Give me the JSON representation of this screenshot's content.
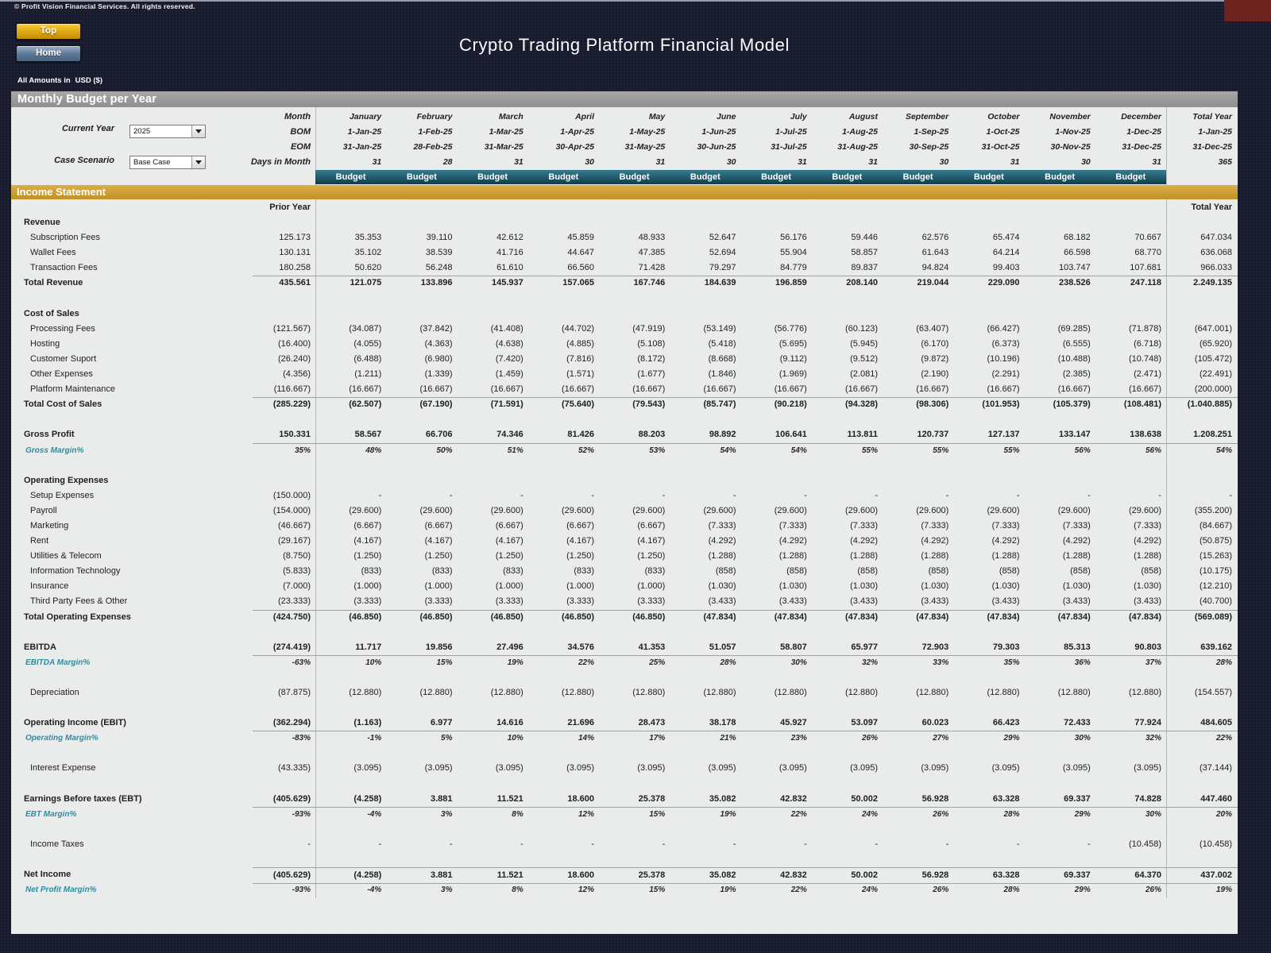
{
  "header": {
    "copyright": "© Profit Vision Financial Services. All rights reserved.",
    "title": "Crypto Trading Platform Financial Model",
    "amounts_label": "All Amounts in",
    "currency": "USD ($)",
    "top_button": "Top",
    "home_button": "Home"
  },
  "section_bar": "Monthly Budget per Year",
  "controls": {
    "current_year_label": "Current Year",
    "current_year_value": "2025",
    "case_scenario_label": "Case Scenario",
    "case_scenario_value": "Base Case"
  },
  "month_header": {
    "row_labels": [
      "Month",
      "BOM",
      "EOM",
      "Days in Month"
    ],
    "budget_label": "Budget",
    "months": [
      {
        "name": "January",
        "bom": "1-Jan-25",
        "eom": "31-Jan-25",
        "days": "31"
      },
      {
        "name": "February",
        "bom": "1-Feb-25",
        "eom": "28-Feb-25",
        "days": "28"
      },
      {
        "name": "March",
        "bom": "1-Mar-25",
        "eom": "31-Mar-25",
        "days": "31"
      },
      {
        "name": "April",
        "bom": "1-Apr-25",
        "eom": "30-Apr-25",
        "days": "30"
      },
      {
        "name": "May",
        "bom": "1-May-25",
        "eom": "31-May-25",
        "days": "31"
      },
      {
        "name": "June",
        "bom": "1-Jun-25",
        "eom": "30-Jun-25",
        "days": "30"
      },
      {
        "name": "July",
        "bom": "1-Jul-25",
        "eom": "31-Jul-25",
        "days": "31"
      },
      {
        "name": "August",
        "bom": "1-Aug-25",
        "eom": "31-Aug-25",
        "days": "31"
      },
      {
        "name": "September",
        "bom": "1-Sep-25",
        "eom": "30-Sep-25",
        "days": "30"
      },
      {
        "name": "October",
        "bom": "1-Oct-25",
        "eom": "31-Oct-25",
        "days": "31"
      },
      {
        "name": "November",
        "bom": "1-Nov-25",
        "eom": "30-Nov-25",
        "days": "30"
      },
      {
        "name": "December",
        "bom": "1-Dec-25",
        "eom": "31-Dec-25",
        "days": "31"
      }
    ],
    "total": {
      "name": "Total Year",
      "bom": "1-Jan-25",
      "eom": "31-Dec-25",
      "days": "365"
    }
  },
  "income_statement": {
    "bar_label": "Income Statement",
    "rows": [
      {
        "type": "colheader",
        "name": "column-header-row",
        "values": [
          "Prior Year",
          "",
          "",
          "",
          "",
          "",
          "",
          "",
          "",
          "",
          "",
          "",
          "",
          "Total Year"
        ]
      },
      {
        "type": "section",
        "name": "row-revenue-section",
        "label": "Revenue"
      },
      {
        "type": "item",
        "name": "row-subscription-fees",
        "label": "Subscription Fees",
        "values": [
          "125.173",
          "35.353",
          "39.110",
          "42.612",
          "45.859",
          "48.933",
          "52.647",
          "56.176",
          "59.446",
          "62.576",
          "65.474",
          "68.182",
          "70.667",
          "647.034"
        ]
      },
      {
        "type": "item",
        "name": "row-wallet-fees",
        "label": "Wallet Fees",
        "values": [
          "130.131",
          "35.102",
          "38.539",
          "41.716",
          "44.647",
          "47.385",
          "52.694",
          "55.904",
          "58.857",
          "61.643",
          "64.214",
          "66.598",
          "68.770",
          "636.068"
        ]
      },
      {
        "type": "item",
        "name": "row-transaction-fees",
        "label": "Transaction Fees",
        "underline": true,
        "values": [
          "180.258",
          "50.620",
          "56.248",
          "61.610",
          "66.560",
          "71.428",
          "79.297",
          "84.779",
          "89.837",
          "94.824",
          "99.403",
          "103.747",
          "107.681",
          "966.033"
        ]
      },
      {
        "type": "total",
        "name": "row-total-revenue",
        "label": "Total Revenue",
        "values": [
          "435.561",
          "121.075",
          "133.896",
          "145.937",
          "157.065",
          "167.746",
          "184.639",
          "196.859",
          "208.140",
          "219.044",
          "229.090",
          "238.526",
          "247.118",
          "2.249.135"
        ]
      },
      {
        "type": "blank"
      },
      {
        "type": "section",
        "name": "row-cost-of-sales-section",
        "label": "Cost of Sales"
      },
      {
        "type": "item",
        "name": "row-processing-fees",
        "label": "Processing Fees",
        "values": [
          "(121.567)",
          "(34.087)",
          "(37.842)",
          "(41.408)",
          "(44.702)",
          "(47.919)",
          "(53.149)",
          "(56.776)",
          "(60.123)",
          "(63.407)",
          "(66.427)",
          "(69.285)",
          "(71.878)",
          "(647.001)"
        ]
      },
      {
        "type": "item",
        "name": "row-hosting",
        "label": "Hosting",
        "values": [
          "(16.400)",
          "(4.055)",
          "(4.363)",
          "(4.638)",
          "(4.885)",
          "(5.108)",
          "(5.418)",
          "(5.695)",
          "(5.945)",
          "(6.170)",
          "(6.373)",
          "(6.555)",
          "(6.718)",
          "(65.920)"
        ]
      },
      {
        "type": "item",
        "name": "row-customer-suport",
        "label": "Customer Suport",
        "values": [
          "(26.240)",
          "(6.488)",
          "(6.980)",
          "(7.420)",
          "(7.816)",
          "(8.172)",
          "(8.668)",
          "(9.112)",
          "(9.512)",
          "(9.872)",
          "(10.196)",
          "(10.488)",
          "(10.748)",
          "(105.472)"
        ]
      },
      {
        "type": "item",
        "name": "row-other-expenses",
        "label": "Other Expenses",
        "values": [
          "(4.356)",
          "(1.211)",
          "(1.339)",
          "(1.459)",
          "(1.571)",
          "(1.677)",
          "(1.846)",
          "(1.969)",
          "(2.081)",
          "(2.190)",
          "(2.291)",
          "(2.385)",
          "(2.471)",
          "(22.491)"
        ]
      },
      {
        "type": "item",
        "name": "row-platform-maintenance",
        "label": "Platform Maintenance",
        "underline": true,
        "values": [
          "(116.667)",
          "(16.667)",
          "(16.667)",
          "(16.667)",
          "(16.667)",
          "(16.667)",
          "(16.667)",
          "(16.667)",
          "(16.667)",
          "(16.667)",
          "(16.667)",
          "(16.667)",
          "(16.667)",
          "(200.000)"
        ]
      },
      {
        "type": "total",
        "name": "row-total-cost-of-sales",
        "label": "Total Cost of Sales",
        "values": [
          "(285.229)",
          "(62.507)",
          "(67.190)",
          "(71.591)",
          "(75.640)",
          "(79.543)",
          "(85.747)",
          "(90.218)",
          "(94.328)",
          "(98.306)",
          "(101.953)",
          "(105.379)",
          "(108.481)",
          "(1.040.885)"
        ]
      },
      {
        "type": "blank"
      },
      {
        "type": "total",
        "name": "row-gross-profit",
        "label": "Gross Profit",
        "underline": true,
        "values": [
          "150.331",
          "58.567",
          "66.706",
          "74.346",
          "81.426",
          "88.203",
          "98.892",
          "106.641",
          "113.811",
          "120.737",
          "127.137",
          "133.147",
          "138.638",
          "1.208.251"
        ]
      },
      {
        "type": "margin",
        "name": "row-gross-margin",
        "label": "Gross Margin%",
        "values": [
          "35%",
          "48%",
          "50%",
          "51%",
          "52%",
          "53%",
          "54%",
          "54%",
          "55%",
          "55%",
          "55%",
          "56%",
          "56%",
          "54%"
        ]
      },
      {
        "type": "blank"
      },
      {
        "type": "section",
        "name": "row-operating-expenses-section",
        "label": "Operating Expenses"
      },
      {
        "type": "item",
        "name": "row-setup-expenses",
        "label": "Setup Expenses",
        "values": [
          "(150.000)",
          "-",
          "-",
          "-",
          "-",
          "-",
          "-",
          "-",
          "-",
          "-",
          "-",
          "-",
          "-",
          "-"
        ]
      },
      {
        "type": "item",
        "name": "row-payroll",
        "label": "Payroll",
        "values": [
          "(154.000)",
          "(29.600)",
          "(29.600)",
          "(29.600)",
          "(29.600)",
          "(29.600)",
          "(29.600)",
          "(29.600)",
          "(29.600)",
          "(29.600)",
          "(29.600)",
          "(29.600)",
          "(29.600)",
          "(355.200)"
        ]
      },
      {
        "type": "item",
        "name": "row-marketing",
        "label": "Marketing",
        "values": [
          "(46.667)",
          "(6.667)",
          "(6.667)",
          "(6.667)",
          "(6.667)",
          "(6.667)",
          "(7.333)",
          "(7.333)",
          "(7.333)",
          "(7.333)",
          "(7.333)",
          "(7.333)",
          "(7.333)",
          "(84.667)"
        ]
      },
      {
        "type": "item",
        "name": "row-rent",
        "label": "Rent",
        "values": [
          "(29.167)",
          "(4.167)",
          "(4.167)",
          "(4.167)",
          "(4.167)",
          "(4.167)",
          "(4.292)",
          "(4.292)",
          "(4.292)",
          "(4.292)",
          "(4.292)",
          "(4.292)",
          "(4.292)",
          "(50.875)"
        ]
      },
      {
        "type": "item",
        "name": "row-utilities-telecom",
        "label": "Utilities & Telecom",
        "values": [
          "(8.750)",
          "(1.250)",
          "(1.250)",
          "(1.250)",
          "(1.250)",
          "(1.250)",
          "(1.288)",
          "(1.288)",
          "(1.288)",
          "(1.288)",
          "(1.288)",
          "(1.288)",
          "(1.288)",
          "(15.263)"
        ]
      },
      {
        "type": "item",
        "name": "row-information-technology",
        "label": "Information Technology",
        "values": [
          "(5.833)",
          "(833)",
          "(833)",
          "(833)",
          "(833)",
          "(833)",
          "(858)",
          "(858)",
          "(858)",
          "(858)",
          "(858)",
          "(858)",
          "(858)",
          "(10.175)"
        ]
      },
      {
        "type": "item",
        "name": "row-insurance",
        "label": "Insurance",
        "values": [
          "(7.000)",
          "(1.000)",
          "(1.000)",
          "(1.000)",
          "(1.000)",
          "(1.000)",
          "(1.030)",
          "(1.030)",
          "(1.030)",
          "(1.030)",
          "(1.030)",
          "(1.030)",
          "(1.030)",
          "(12.210)"
        ]
      },
      {
        "type": "item",
        "name": "row-third-party-fees",
        "label": "Third Party Fees & Other",
        "underline": true,
        "values": [
          "(23.333)",
          "(3.333)",
          "(3.333)",
          "(3.333)",
          "(3.333)",
          "(3.333)",
          "(3.433)",
          "(3.433)",
          "(3.433)",
          "(3.433)",
          "(3.433)",
          "(3.433)",
          "(3.433)",
          "(40.700)"
        ]
      },
      {
        "type": "total",
        "name": "row-total-operating-expenses",
        "label": "Total Operating Expenses",
        "values": [
          "(424.750)",
          "(46.850)",
          "(46.850)",
          "(46.850)",
          "(46.850)",
          "(46.850)",
          "(47.834)",
          "(47.834)",
          "(47.834)",
          "(47.834)",
          "(47.834)",
          "(47.834)",
          "(47.834)",
          "(569.089)"
        ]
      },
      {
        "type": "blank"
      },
      {
        "type": "total",
        "name": "row-ebitda",
        "label": "EBITDA",
        "underline": true,
        "values": [
          "(274.419)",
          "11.717",
          "19.856",
          "27.496",
          "34.576",
          "41.353",
          "51.057",
          "58.807",
          "65.977",
          "72.903",
          "79.303",
          "85.313",
          "90.803",
          "639.162"
        ]
      },
      {
        "type": "margin",
        "name": "row-ebitda-margin",
        "label": "EBITDA Margin%",
        "values": [
          "-63%",
          "10%",
          "15%",
          "19%",
          "22%",
          "25%",
          "28%",
          "30%",
          "32%",
          "33%",
          "35%",
          "36%",
          "37%",
          "28%"
        ]
      },
      {
        "type": "blank"
      },
      {
        "type": "item",
        "name": "row-depreciation",
        "label": "Depreciation",
        "values": [
          "(87.875)",
          "(12.880)",
          "(12.880)",
          "(12.880)",
          "(12.880)",
          "(12.880)",
          "(12.880)",
          "(12.880)",
          "(12.880)",
          "(12.880)",
          "(12.880)",
          "(12.880)",
          "(12.880)",
          "(154.557)"
        ]
      },
      {
        "type": "blank"
      },
      {
        "type": "total",
        "name": "row-operating-income-ebit",
        "label": "Operating Income (EBIT)",
        "underline": true,
        "values": [
          "(362.294)",
          "(1.163)",
          "6.977",
          "14.616",
          "21.696",
          "28.473",
          "38.178",
          "45.927",
          "53.097",
          "60.023",
          "66.423",
          "72.433",
          "77.924",
          "484.605"
        ]
      },
      {
        "type": "margin",
        "name": "row-operating-margin",
        "label": "Operating Margin%",
        "values": [
          "-83%",
          "-1%",
          "5%",
          "10%",
          "14%",
          "17%",
          "21%",
          "23%",
          "26%",
          "27%",
          "29%",
          "30%",
          "32%",
          "22%"
        ]
      },
      {
        "type": "blank"
      },
      {
        "type": "item",
        "name": "row-interest-expense",
        "label": "Interest Expense",
        "values": [
          "(43.335)",
          "(3.095)",
          "(3.095)",
          "(3.095)",
          "(3.095)",
          "(3.095)",
          "(3.095)",
          "(3.095)",
          "(3.095)",
          "(3.095)",
          "(3.095)",
          "(3.095)",
          "(3.095)",
          "(37.144)"
        ]
      },
      {
        "type": "blank"
      },
      {
        "type": "total",
        "name": "row-earnings-before-taxes",
        "label": "Earnings Before taxes (EBT)",
        "underline": true,
        "values": [
          "(405.629)",
          "(4.258)",
          "3.881",
          "11.521",
          "18.600",
          "25.378",
          "35.082",
          "42.832",
          "50.002",
          "56.928",
          "63.328",
          "69.337",
          "74.828",
          "447.460"
        ]
      },
      {
        "type": "margin",
        "name": "row-ebt-margin",
        "label": "EBT Margin%",
        "values": [
          "-93%",
          "-4%",
          "3%",
          "8%",
          "12%",
          "15%",
          "19%",
          "22%",
          "24%",
          "26%",
          "28%",
          "29%",
          "30%",
          "20%"
        ]
      },
      {
        "type": "blank"
      },
      {
        "type": "item",
        "name": "row-income-taxes",
        "label": "Income Taxes",
        "values": [
          "-",
          "-",
          "-",
          "-",
          "-",
          "-",
          "-",
          "-",
          "-",
          "-",
          "-",
          "-",
          "(10.458)",
          "(10.458)"
        ]
      },
      {
        "type": "blank"
      },
      {
        "type": "total",
        "name": "row-net-income",
        "label": "Net Income",
        "topline": true,
        "underline": true,
        "values": [
          "(405.629)",
          "(4.258)",
          "3.881",
          "11.521",
          "18.600",
          "25.378",
          "35.082",
          "42.832",
          "50.002",
          "56.928",
          "63.328",
          "69.337",
          "64.370",
          "437.002"
        ]
      },
      {
        "type": "margin",
        "name": "row-net-profit-margin",
        "label": "Net Profit Margin%",
        "values": [
          "-93%",
          "-4%",
          "3%",
          "8%",
          "12%",
          "15%",
          "19%",
          "22%",
          "24%",
          "26%",
          "28%",
          "29%",
          "26%",
          "19%"
        ]
      }
    ]
  },
  "colors": {
    "margin_text": "#2e8ca0",
    "band_teal_top": "#357c8e",
    "band_teal_bottom": "#0f3e4d",
    "gold_bar": "#c79b2f",
    "gray_bar": "#9b9b9b",
    "sheet_bg": "#eaecec",
    "page_bg": "#171b2d",
    "top_button_gold": "#e0a812",
    "home_button_blue": "#5b7795",
    "corner_red": "#6e221e"
  }
}
